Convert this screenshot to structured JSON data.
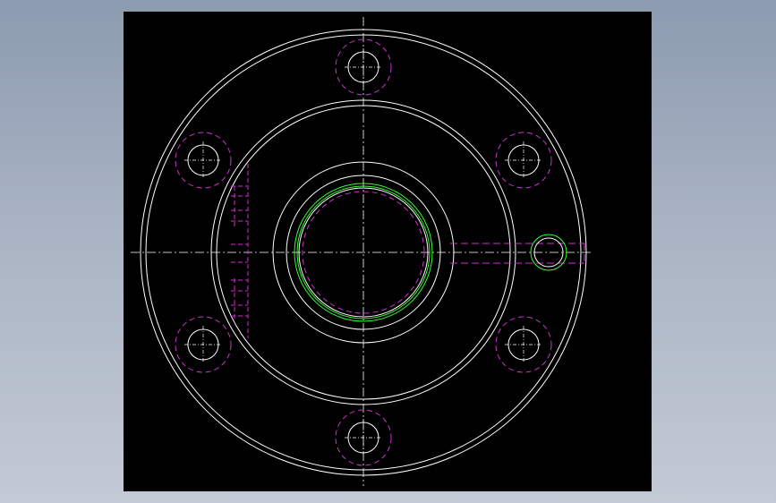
{
  "viewport": {
    "background": "#000000"
  },
  "palette": {
    "outline": "#ffffff",
    "hidden": "#cc33cc",
    "highlight": "#33ff33"
  },
  "drawing": {
    "view": "flange-top-view",
    "bolt_hole_count": 6,
    "features": [
      "outer-rim",
      "raised-face",
      "hub",
      "bore",
      "bolt-holes",
      "side-port",
      "threaded-hole",
      "centerlines"
    ]
  }
}
